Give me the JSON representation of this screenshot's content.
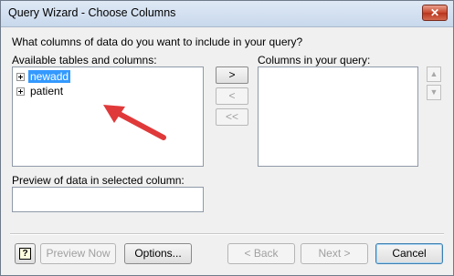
{
  "window": {
    "title": "Query Wizard - Choose Columns",
    "close_glyph": "✕"
  },
  "prompt": "What columns of data do you want to include in your query?",
  "available": {
    "label": "Available tables and columns:",
    "items": [
      {
        "label": "newadd",
        "selected": true
      },
      {
        "label": "patient",
        "selected": false
      }
    ]
  },
  "columns": {
    "label": "Columns in your query:"
  },
  "move_buttons": {
    "add": ">",
    "remove": "<",
    "remove_all": "<<"
  },
  "scroll": {
    "up": "▲",
    "down": "▼"
  },
  "preview": {
    "label": "Preview of data in selected column:",
    "value": ""
  },
  "footer": {
    "help_glyph": "?",
    "preview_now": "Preview Now",
    "options": "Options...",
    "back": "< Back",
    "next": "Next >",
    "cancel": "Cancel"
  },
  "annotation": {
    "arrow_color": "#e0393a"
  }
}
